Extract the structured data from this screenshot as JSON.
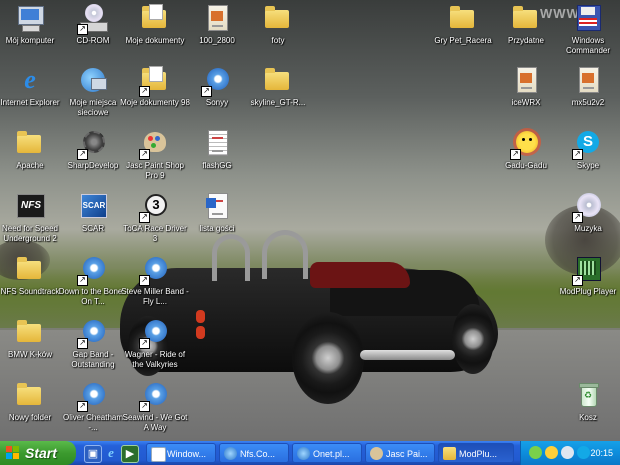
{
  "watermark": "WWW.",
  "desktop_icons": {
    "left": [
      {
        "label": "Mój komputer",
        "icon": "computer-icon"
      },
      {
        "label": "CD-ROM",
        "icon": "cd-drive-icon"
      },
      {
        "label": "Moje dokumenty",
        "icon": "folder-documents-icon"
      },
      {
        "label": "100_2800",
        "icon": "image-file-icon"
      },
      {
        "label": "foty",
        "icon": "folder-icon"
      },
      {
        "label": "Internet Explorer",
        "icon": "internet-explorer-icon"
      },
      {
        "label": "Moje miejsca sieciowe",
        "icon": "network-places-icon"
      },
      {
        "label": "Moje dokumenty 98",
        "icon": "folder-documents-icon"
      },
      {
        "label": "Sonyy",
        "icon": "media-shortcut-icon"
      },
      {
        "label": "skyline_GT-R...",
        "icon": "folder-icon"
      },
      {
        "label": "Apache",
        "icon": "folder-icon"
      },
      {
        "label": "SharpDevelop",
        "icon": "sharpdevelop-icon"
      },
      {
        "label": "Jasc Paint Shop Pro 9",
        "icon": "paint-shop-pro-icon"
      },
      {
        "label": "flashGG",
        "icon": "text-file-icon"
      },
      {
        "label": "Need for Speed Underground 2",
        "icon": "nfs-game-icon"
      },
      {
        "label": "SCAR",
        "icon": "scar-game-icon"
      },
      {
        "label": "ToCA Race Driver 3",
        "icon": "toca-game-icon"
      },
      {
        "label": "lista gości",
        "icon": "document-icon"
      },
      {
        "label": "NFS Soundtrack",
        "icon": "folder-icon"
      },
      {
        "label": "Down to the Bone - On T...",
        "icon": "media-shortcut-icon"
      },
      {
        "label": "Steve Miller Band - Fly L...",
        "icon": "media-shortcut-icon"
      },
      {
        "label": "BMW K-ków",
        "icon": "folder-icon"
      },
      {
        "label": "Gap Band - Outstanding",
        "icon": "media-shortcut-icon"
      },
      {
        "label": "Wagner - Ride of the Valkyries",
        "icon": "media-shortcut-icon"
      },
      {
        "label": "Nowy folder",
        "icon": "folder-icon"
      },
      {
        "label": "Oliver Cheatham -...",
        "icon": "media-shortcut-icon"
      },
      {
        "label": "Seawind - We Got A Way",
        "icon": "media-shortcut-icon"
      }
    ],
    "right": [
      {
        "label": "Gry Pet_Racera",
        "icon": "folder-icon"
      },
      {
        "label": "Przydatne",
        "icon": "folder-icon"
      },
      {
        "label": "Windows Commander",
        "icon": "windows-commander-icon"
      },
      {
        "label": "iceWRX",
        "icon": "image-file-icon"
      },
      {
        "label": "mx5u2v2",
        "icon": "image-file-icon"
      },
      {
        "label": "Gadu-Gadu",
        "icon": "gadu-gadu-icon"
      },
      {
        "label": "Skype",
        "icon": "skype-icon"
      },
      {
        "label": "Muzyka",
        "icon": "music-cd-icon"
      },
      {
        "label": "ModPlug Player",
        "icon": "modplug-icon"
      },
      {
        "label": "Kosz",
        "icon": "recycle-bin-icon"
      }
    ]
  },
  "taskbar": {
    "start_label": "Start",
    "quick_launch": [
      "show-desktop-icon",
      "internet-explorer-icon",
      "media-icon"
    ],
    "buttons": [
      {
        "label": "Window...",
        "icon": "window-icon"
      },
      {
        "label": "Nfs.Co...",
        "icon": "globe-icon"
      },
      {
        "label": "Onet.pl...",
        "icon": "globe-icon"
      },
      {
        "label": "Jasc Pai...",
        "icon": "paint-shop-pro-icon"
      },
      {
        "label": "ModPlu...",
        "icon": "folder-icon"
      }
    ],
    "clock": "20:15"
  }
}
